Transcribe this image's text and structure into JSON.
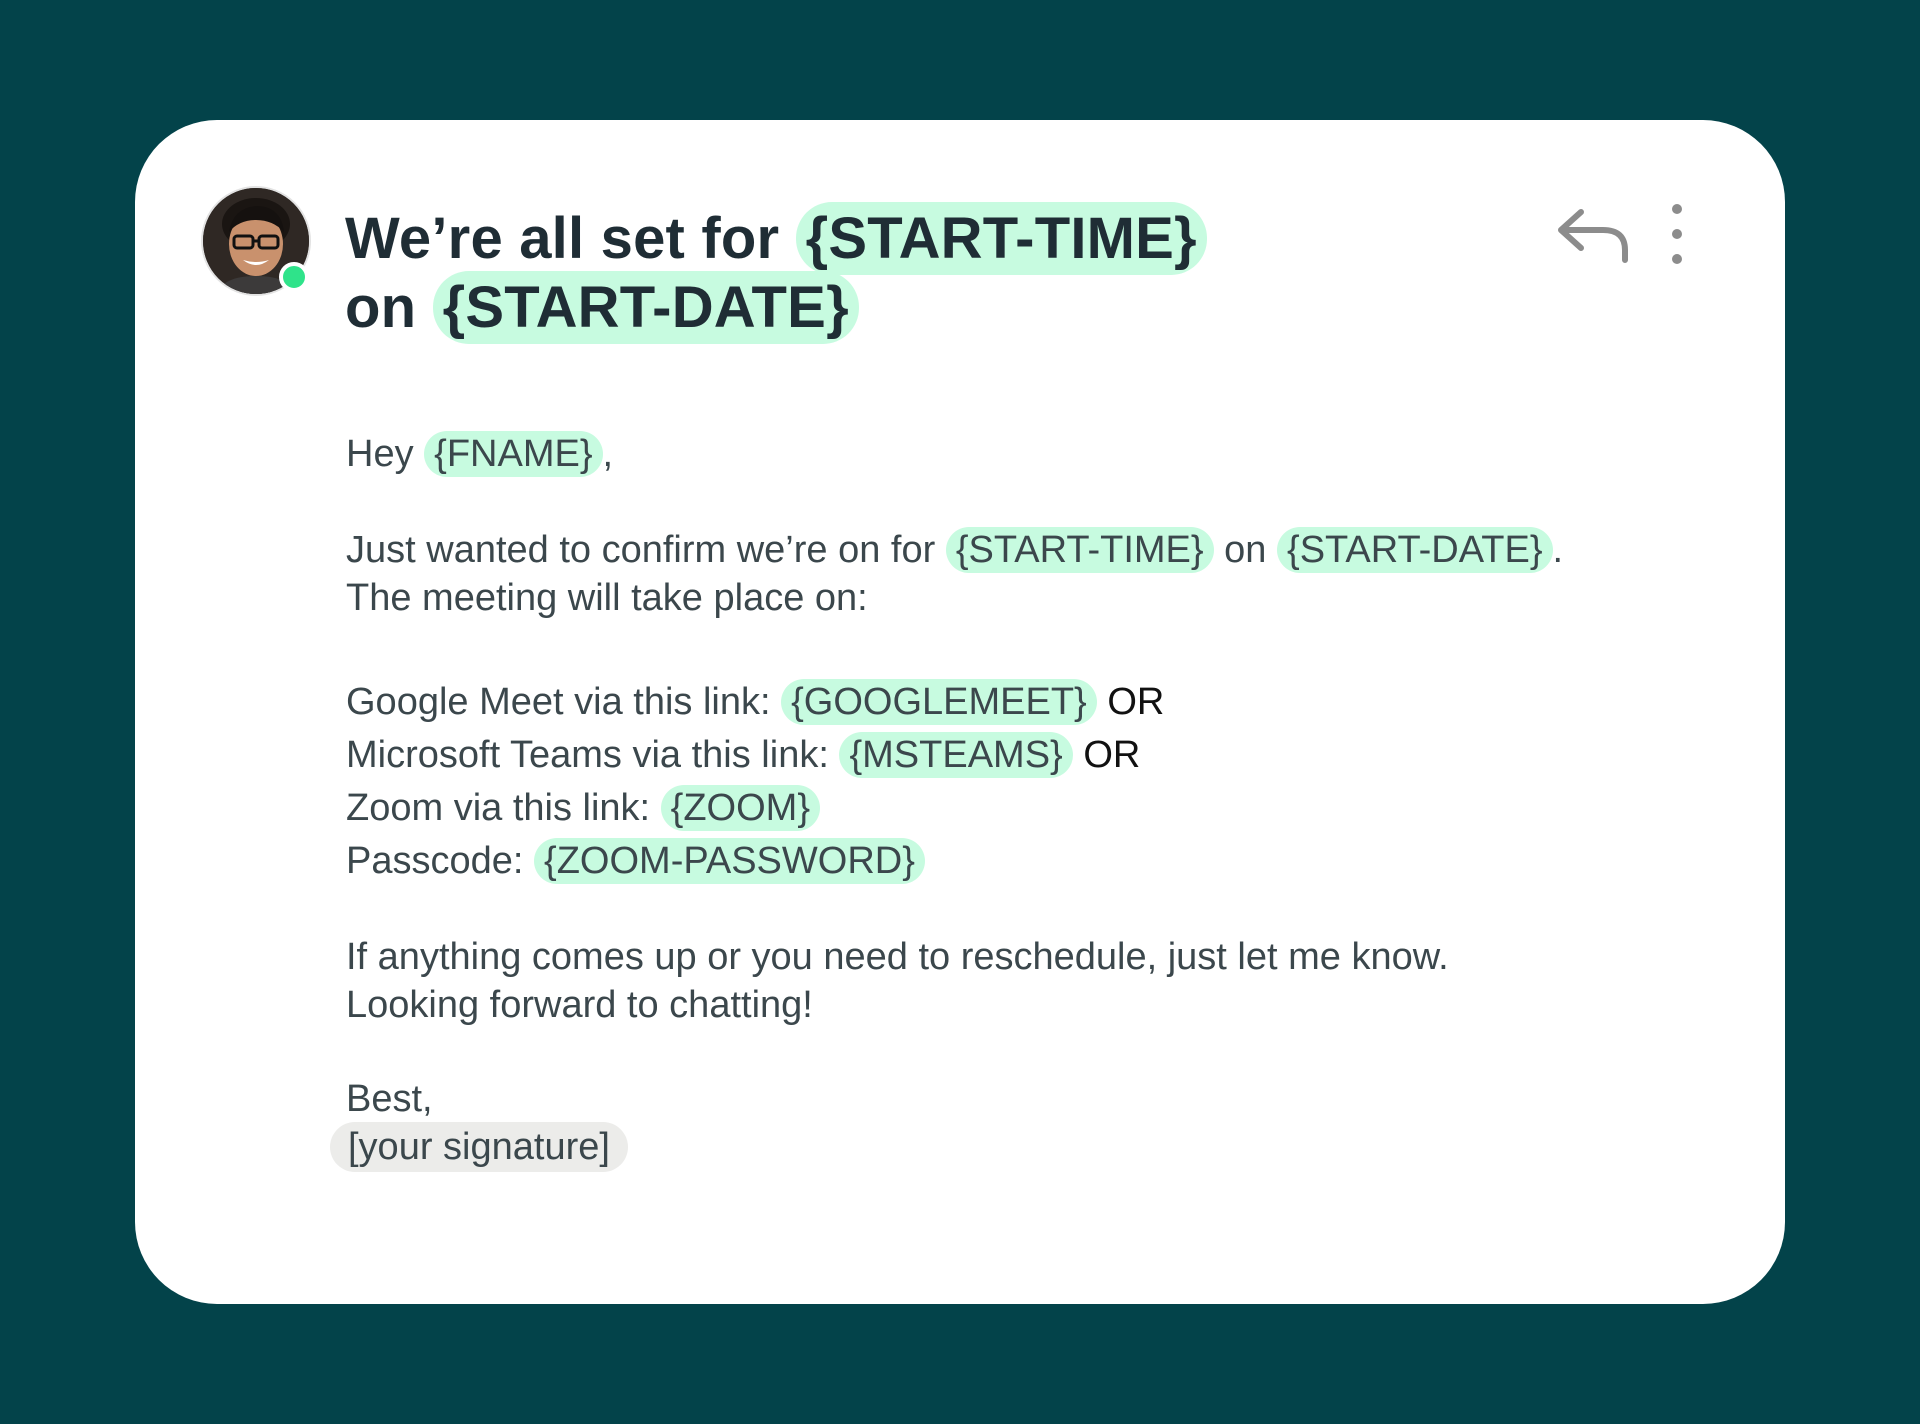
{
  "colors": {
    "background": "#03434a",
    "card": "#ffffff",
    "placeholder_highlight": "#c7fbe0",
    "signature_highlight": "#ececea",
    "online_status": "#2fe38a"
  },
  "sender": {
    "avatar_icon": "person-avatar",
    "status": "online"
  },
  "email": {
    "subject": {
      "prefix": "We’re all set for",
      "time_tag": "{START-TIME}",
      "mid": "on",
      "date_tag": "{START-DATE}"
    },
    "greeting": {
      "text": "Hey",
      "tag": "{FNAME}",
      "end": ","
    },
    "confirm": {
      "prefix": "Just wanted to confirm we’re on for",
      "time_tag": "{START-TIME}",
      "mid": "on",
      "date_tag": "{START-DATE}",
      "end": ".",
      "line2": "The meeting will take place on:"
    },
    "links": [
      {
        "label": "Google Meet via this link:",
        "tag": "{GOOGLEMEET}",
        "suffix": "OR"
      },
      {
        "label": "Microsoft Teams via this link:",
        "tag": "{MSTEAMS}",
        "suffix": "OR"
      },
      {
        "label": "Zoom via this link:",
        "tag": "{ZOOM}",
        "suffix": ""
      },
      {
        "label": "Passcode:",
        "tag": "{ZOOM-PASSWORD}",
        "suffix": ""
      }
    ],
    "closing": {
      "line1": "If anything comes up or you need to reschedule, just let me know.",
      "line2": "Looking forward to chatting!"
    },
    "signoff": "Best,",
    "signature": "[your signature]"
  },
  "actions": {
    "reply_icon": "reply-icon",
    "more_icon": "more-vertical-icon"
  }
}
